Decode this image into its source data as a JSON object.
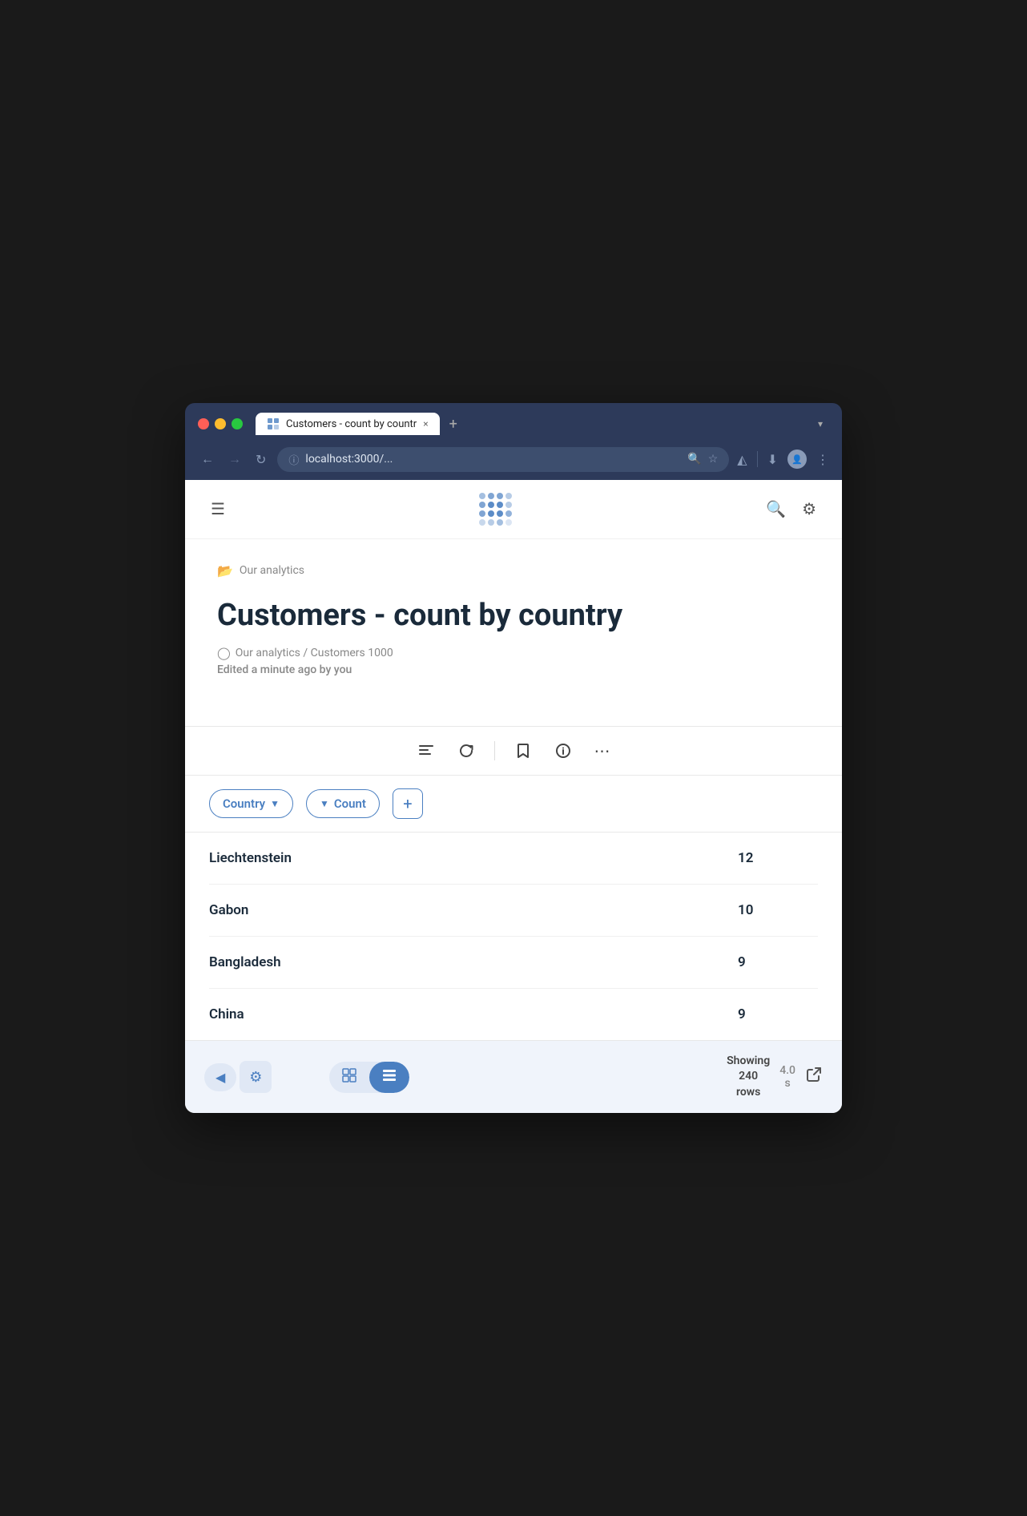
{
  "browser": {
    "tab_title": "Customers - count by countr",
    "url": "localhost:3000/...",
    "tab_close": "×",
    "tab_new": "+",
    "tab_dropdown": "▾"
  },
  "header": {
    "search_label": "Search",
    "settings_label": "Settings",
    "hamburger_label": "Menu"
  },
  "breadcrumb": {
    "folder_label": "Our analytics"
  },
  "page": {
    "title": "Customers - count by country",
    "meta_icon": "cube",
    "meta_path": "Our analytics  /  Customers 1000",
    "edited": "Edited a minute ago by you"
  },
  "toolbar": {
    "columns_icon": "columns",
    "refresh_icon": "refresh",
    "bookmark_icon": "bookmark",
    "info_icon": "info",
    "more_icon": "more"
  },
  "table": {
    "columns": [
      {
        "label": "Country",
        "type": "dimension"
      },
      {
        "label": "Count",
        "type": "metric"
      }
    ],
    "rows": [
      {
        "country": "Liechtenstein",
        "count": "12"
      },
      {
        "country": "Gabon",
        "count": "10"
      },
      {
        "country": "Bangladesh",
        "count": "9"
      },
      {
        "country": "China",
        "count": "9"
      }
    ],
    "add_column_label": "+"
  },
  "footer": {
    "gear_icon": "⚙",
    "view_grid_icon": "grid",
    "view_list_icon": "list",
    "showing": "Showing",
    "rows_count": "240",
    "rows_label": "rows",
    "timing": "4.0",
    "timing_unit": "s",
    "external_link": "↗"
  }
}
